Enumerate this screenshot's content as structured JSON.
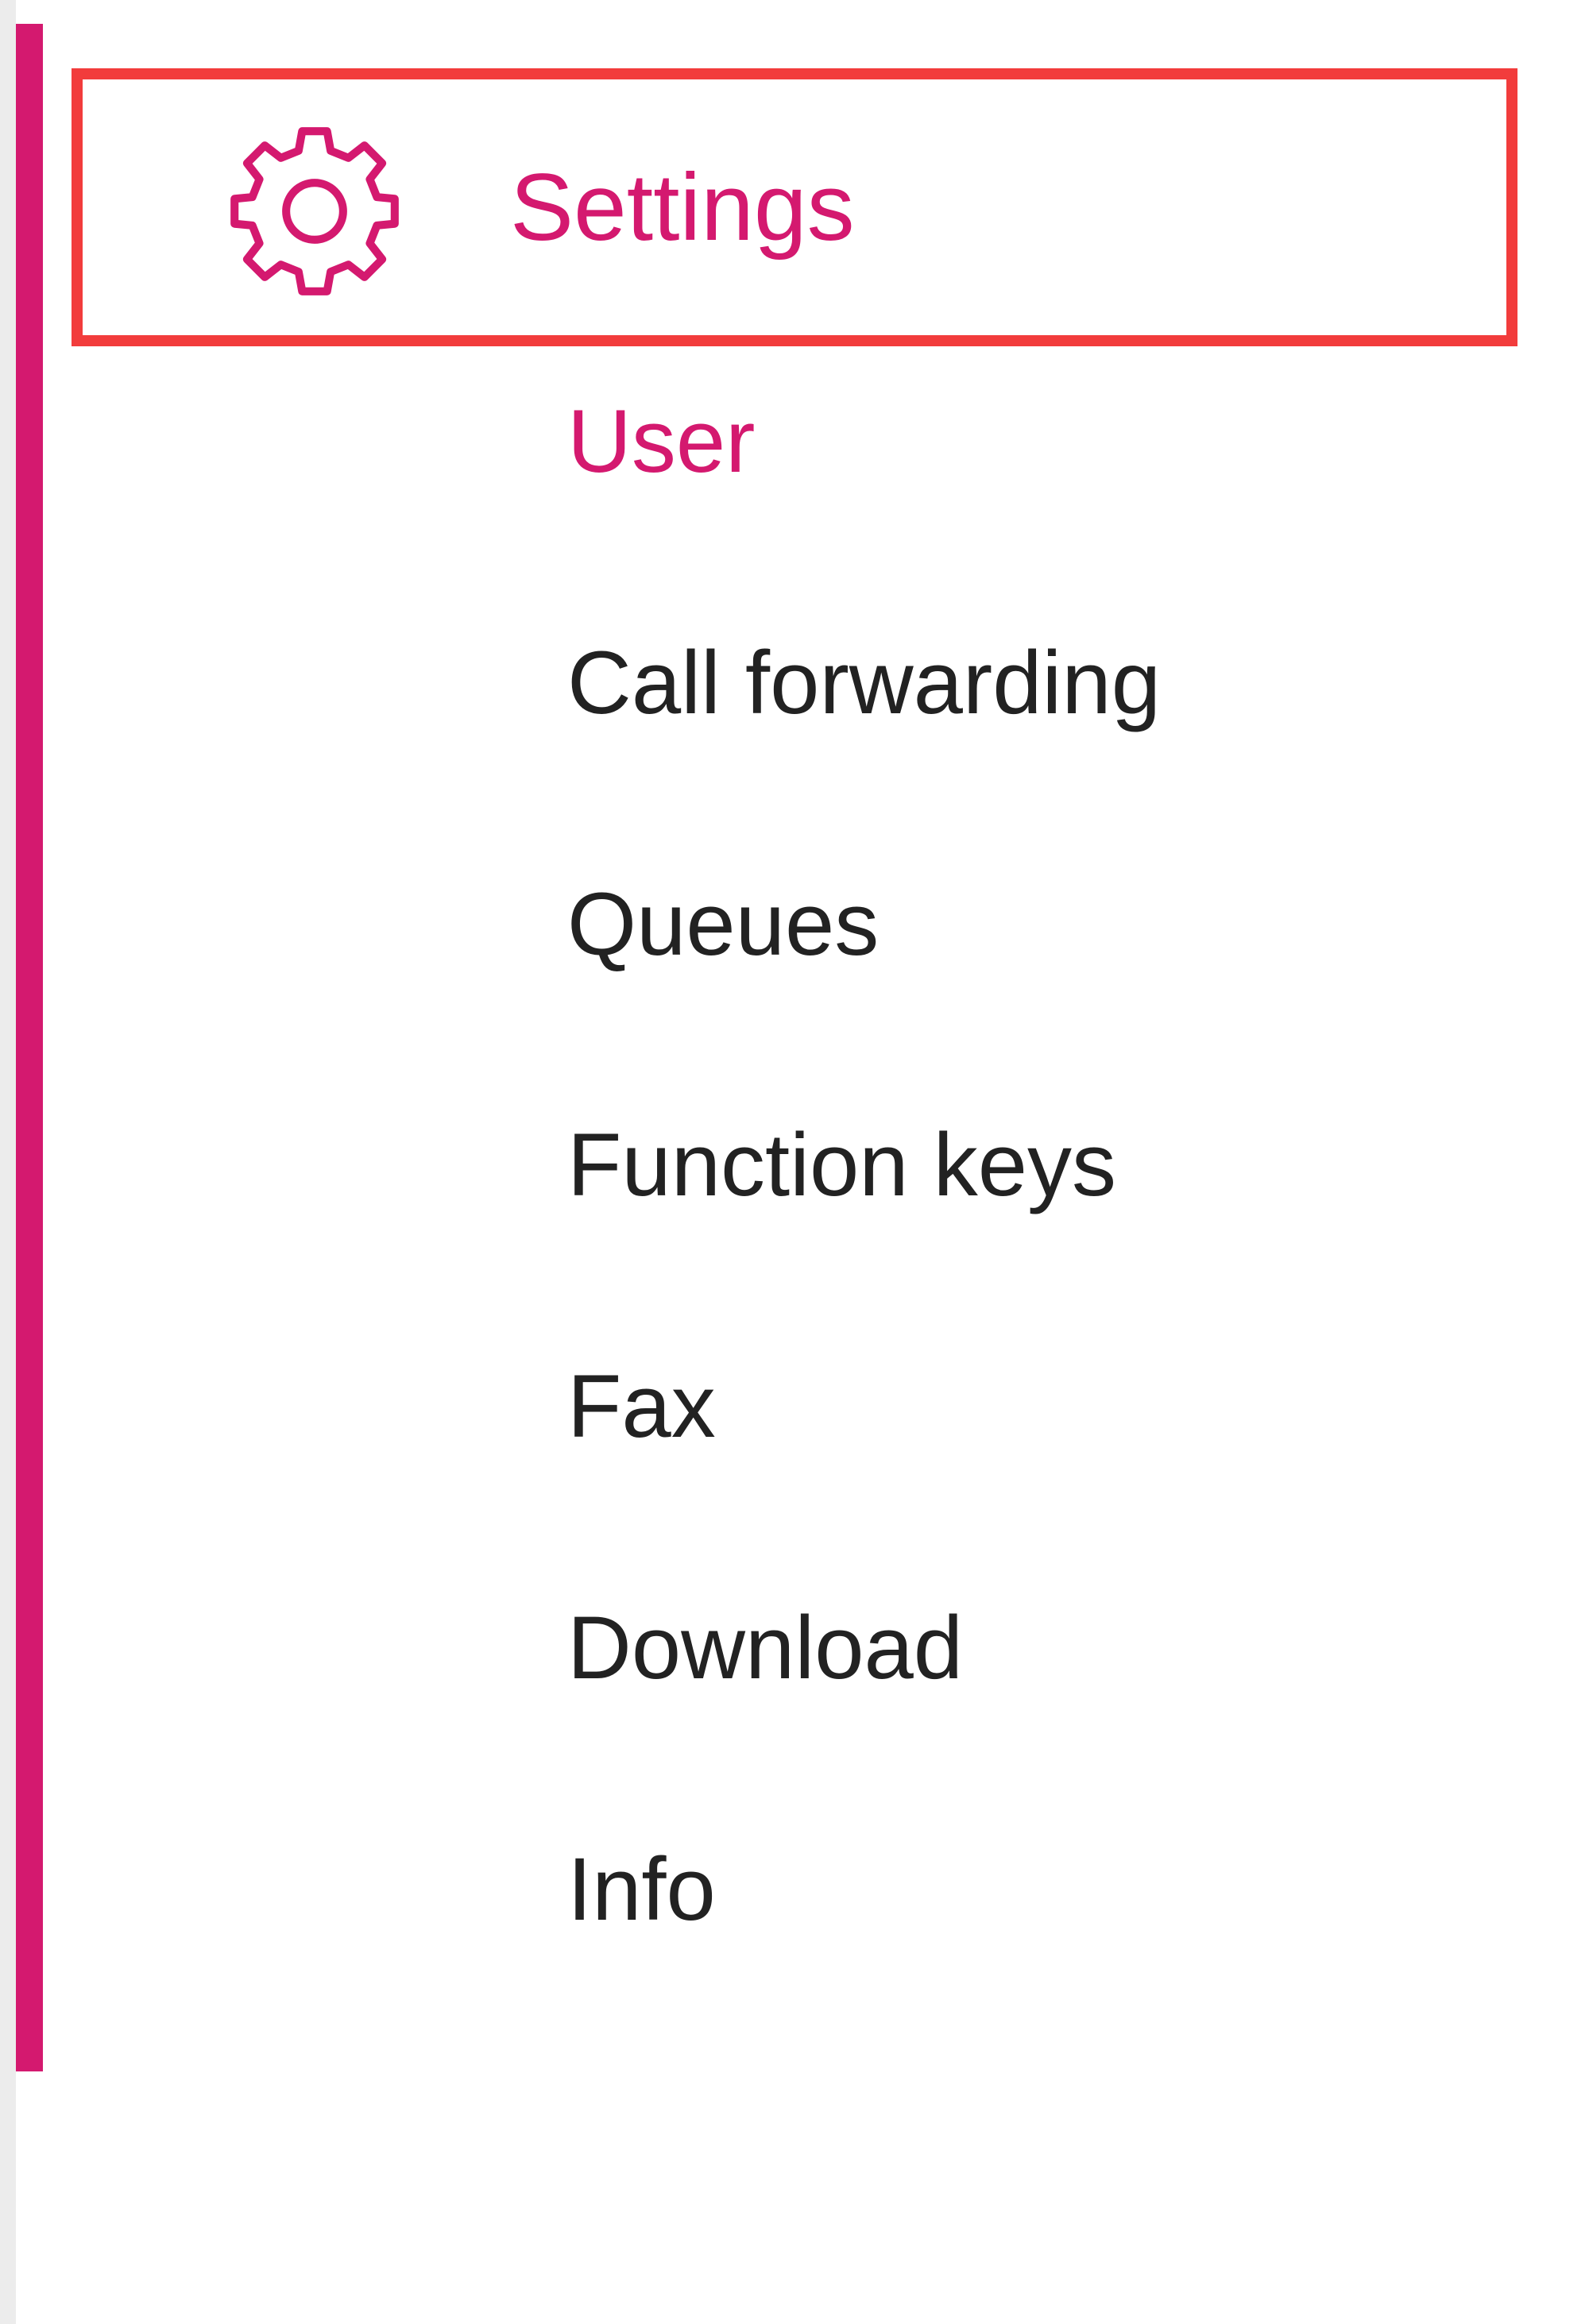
{
  "colors": {
    "accent": "#d4196f",
    "highlight_border": "#f23c3c",
    "text": "#222222",
    "background": "#ffffff"
  },
  "settings": {
    "label": "Settings",
    "icon": "gear-icon"
  },
  "submenu": {
    "active": "User",
    "items": [
      {
        "label": "User"
      },
      {
        "label": "Call forwarding"
      },
      {
        "label": "Queues"
      },
      {
        "label": "Function keys"
      },
      {
        "label": "Fax"
      },
      {
        "label": "Download"
      },
      {
        "label": "Info"
      }
    ]
  }
}
